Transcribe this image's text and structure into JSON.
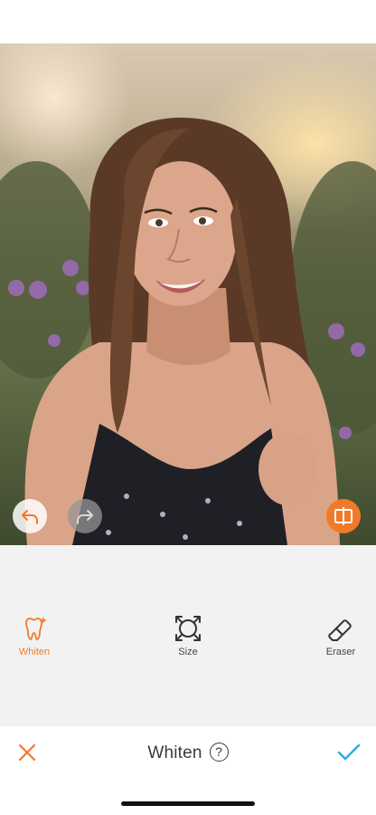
{
  "tools": [
    {
      "label": "Whiten",
      "icon": "tooth-sparkle-icon",
      "active": true
    },
    {
      "label": "Size",
      "icon": "resize-frame-icon",
      "active": false
    },
    {
      "label": "Eraser",
      "icon": "eraser-icon",
      "active": false
    }
  ],
  "bottom_bar": {
    "title": "Whiten",
    "help_glyph": "?",
    "cancel_icon": "close-icon",
    "confirm_icon": "checkmark-icon"
  },
  "canvas_controls": {
    "undo_icon": "undo-icon",
    "redo_icon": "redo-icon",
    "compare_icon": "compare-icon"
  },
  "colors": {
    "accent": "#f07a28",
    "confirm": "#2fa9e0",
    "panel_background": "#f2f2f2"
  }
}
